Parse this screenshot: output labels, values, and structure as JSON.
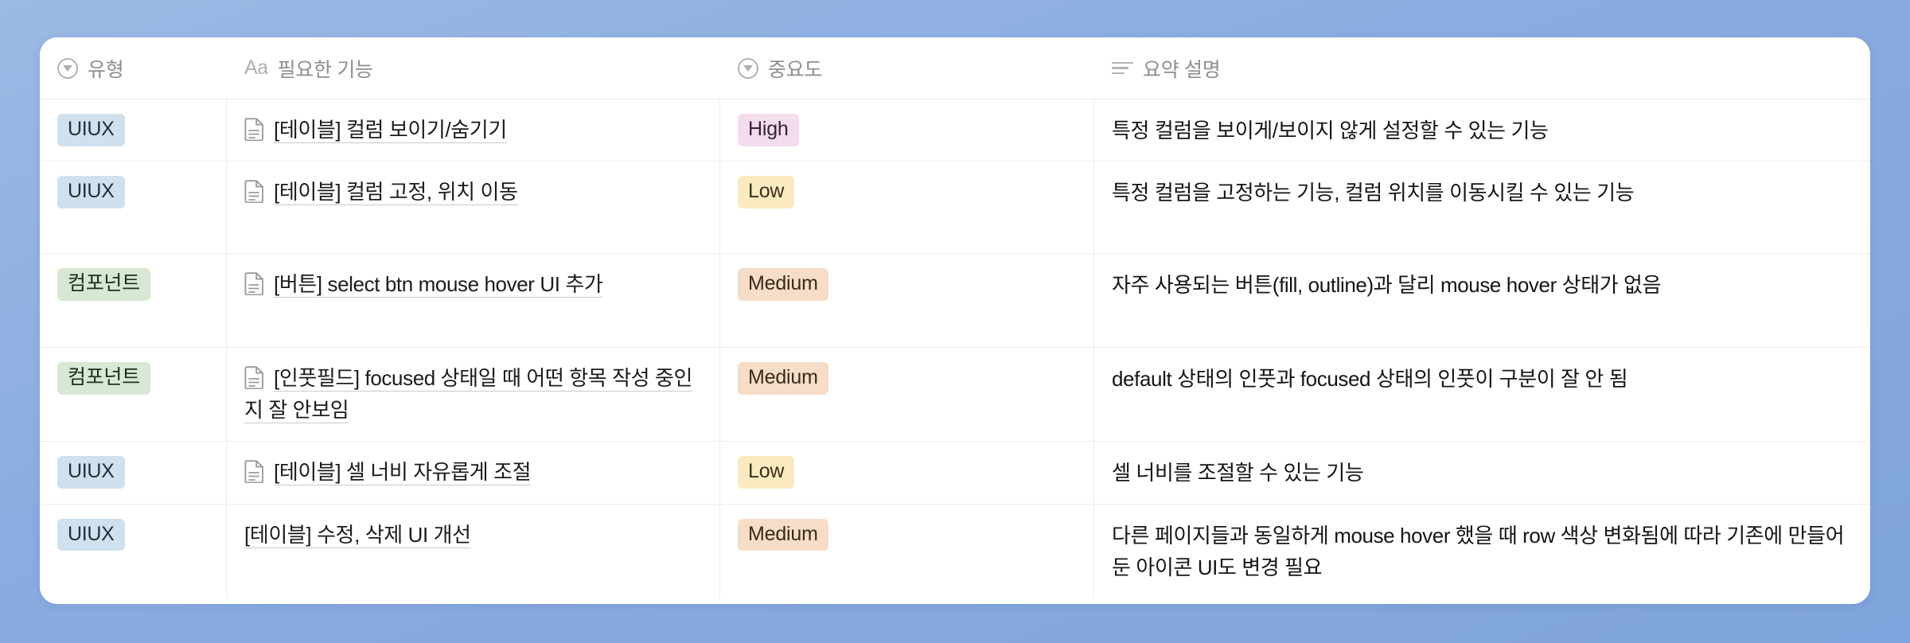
{
  "table": {
    "columns": [
      {
        "label": "유형",
        "icon": "select-circle-icon"
      },
      {
        "label": "필요한 기능",
        "icon": "aa-text-icon"
      },
      {
        "label": "중요도",
        "icon": "select-circle-icon"
      },
      {
        "label": "요약 설명",
        "icon": "text-lines-icon"
      }
    ],
    "icon_glyphs": {
      "aa": "Aa"
    },
    "colors": {
      "page_background": "#8aabe0",
      "card_background": "#ffffff",
      "tag_uiux_bg": "#cfe0ee",
      "tag_component_bg": "#d8e8d3",
      "priority_high_bg": "#f3dded",
      "priority_low_bg": "#faeabf",
      "priority_medium_bg": "#f6ddc7",
      "row_divider": "#ededed"
    },
    "rows": [
      {
        "type": "UIUX",
        "type_style": "uiux",
        "feature": "[테이블] 컬럼 보이기/숨기기",
        "has_doc_icon": true,
        "priority": "High",
        "priority_style": "high",
        "description": "특정 컬럼을 보이게/보이지 않게 설정할 수 있는 기능"
      },
      {
        "type": "UIUX",
        "type_style": "uiux",
        "feature": "[테이블] 컬럼 고정, 위치 이동",
        "has_doc_icon": true,
        "priority": "Low",
        "priority_style": "low",
        "description": "특정 컬럼을 고정하는 기능, 컬럼 위치를 이동시킬 수 있는 기능"
      },
      {
        "type": "컴포넌트",
        "type_style": "component",
        "feature": "[버튼] select btn mouse hover UI 추가",
        "has_doc_icon": true,
        "priority": "Medium",
        "priority_style": "medium",
        "description": "자주 사용되는 버튼(fill, outline)과 달리 mouse hover 상태가 없음"
      },
      {
        "type": "컴포넌트",
        "type_style": "component",
        "feature": "[인풋필드] focused 상태일 때 어떤 항목 작성 중인지 잘 안보임",
        "has_doc_icon": true,
        "priority": "Medium",
        "priority_style": "medium",
        "description": "default 상태의 인풋과 focused 상태의 인풋이 구분이 잘 안 됨"
      },
      {
        "type": "UIUX",
        "type_style": "uiux",
        "feature": "[테이블] 셀 너비 자유롭게 조절",
        "has_doc_icon": true,
        "priority": "Low",
        "priority_style": "low",
        "description": "셀 너비를 조절할 수 있는 기능"
      },
      {
        "type": "UIUX",
        "type_style": "uiux",
        "feature": "[테이블] 수정, 삭제 UI 개선",
        "has_doc_icon": false,
        "priority": "Medium",
        "priority_style": "medium",
        "description": "다른 페이지들과 동일하게 mouse hover 했을 때 row 색상 변화됨에 따라 기존에 만들어 둔 아이콘 UI도 변경 필요"
      }
    ]
  }
}
